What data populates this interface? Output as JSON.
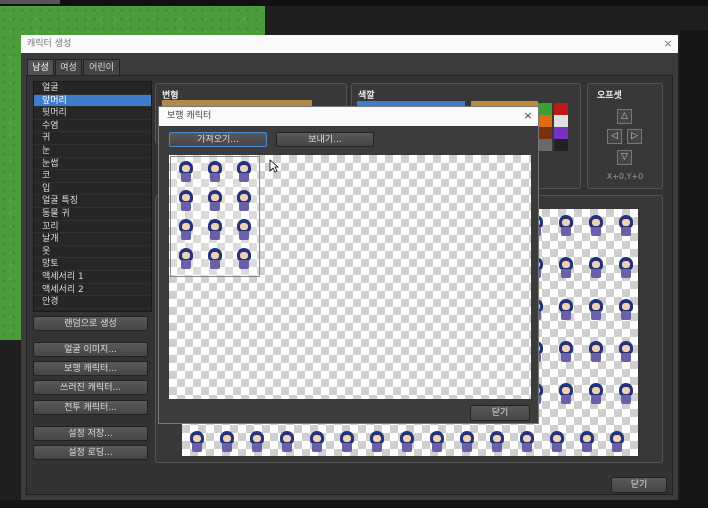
{
  "window": {
    "title": "캐릭터 생성",
    "close": "×"
  },
  "tabs": [
    "남성",
    "여성",
    "어린이"
  ],
  "parts": [
    "얼굴",
    "앞머리",
    "뒷머리",
    "수염",
    "귀",
    "눈",
    "눈썹",
    "코",
    "입",
    "얼굴 특징",
    "동물 귀",
    "꼬리",
    "날개",
    "옷",
    "망토",
    "액세서리 1",
    "액세서리 2",
    "안경"
  ],
  "selected_part_index": 1,
  "left_buttons": {
    "random": "랜덤으로 생성",
    "face_image": "얼굴 이미지...",
    "walk_char": "보행 캐릭터...",
    "down_char": "쓰러진 캐릭터...",
    "battle_char": "전투 캐릭터...",
    "save_settings": "설정 저장...",
    "load_settings": "설정 로딩..."
  },
  "groups": {
    "variation": "변형",
    "color": "색깔",
    "offset": "오프셋"
  },
  "offset": {
    "value": "X+0,Y+0",
    "up": "△",
    "left": "◁",
    "right": "▷",
    "down": "▽"
  },
  "colors": {
    "selected_row": "#3f7ccc",
    "selection_list": "#3f7ccc",
    "swatches": [
      "#b5873b",
      "#8a5a2a",
      "#c01818",
      "#e0e0e0",
      "#e06a10",
      "#7a30c0",
      "#3aa030",
      "#222222"
    ]
  },
  "dialog": {
    "title": "보행 캐릭터",
    "close": "×",
    "import": "가져오기...",
    "export": "보내기...",
    "close_button": "닫기"
  },
  "main_close": "닫기"
}
